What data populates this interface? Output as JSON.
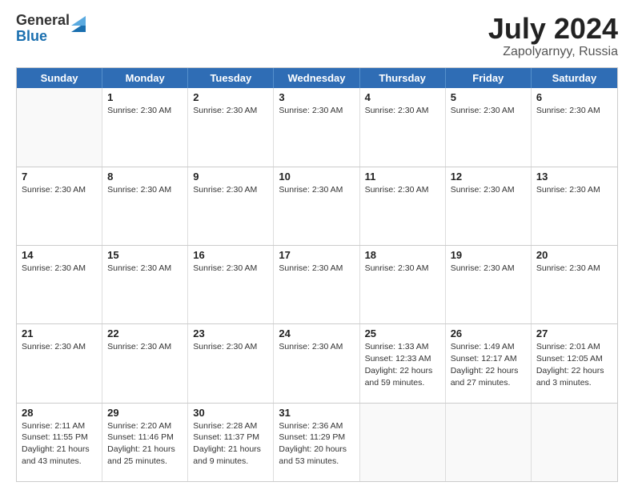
{
  "header": {
    "logo_general": "General",
    "logo_blue": "Blue",
    "main_title": "July 2024",
    "subtitle": "Zapolyarnyy, Russia"
  },
  "calendar": {
    "days_of_week": [
      "Sunday",
      "Monday",
      "Tuesday",
      "Wednesday",
      "Thursday",
      "Friday",
      "Saturday"
    ],
    "weeks": [
      [
        {
          "day": "",
          "info": []
        },
        {
          "day": "1",
          "info": [
            "Sunrise: 2:30 AM"
          ]
        },
        {
          "day": "2",
          "info": [
            "Sunrise: 2:30 AM"
          ]
        },
        {
          "day": "3",
          "info": [
            "Sunrise: 2:30 AM"
          ]
        },
        {
          "day": "4",
          "info": [
            "Sunrise: 2:30 AM"
          ]
        },
        {
          "day": "5",
          "info": [
            "Sunrise: 2:30 AM"
          ]
        },
        {
          "day": "6",
          "info": [
            "Sunrise: 2:30 AM"
          ]
        }
      ],
      [
        {
          "day": "7",
          "info": [
            "Sunrise: 2:30 AM"
          ]
        },
        {
          "day": "8",
          "info": [
            "Sunrise: 2:30 AM"
          ]
        },
        {
          "day": "9",
          "info": [
            "Sunrise: 2:30 AM"
          ]
        },
        {
          "day": "10",
          "info": [
            "Sunrise: 2:30 AM"
          ]
        },
        {
          "day": "11",
          "info": [
            "Sunrise: 2:30 AM"
          ]
        },
        {
          "day": "12",
          "info": [
            "Sunrise: 2:30 AM"
          ]
        },
        {
          "day": "13",
          "info": [
            "Sunrise: 2:30 AM"
          ]
        }
      ],
      [
        {
          "day": "14",
          "info": [
            "Sunrise: 2:30 AM"
          ]
        },
        {
          "day": "15",
          "info": [
            "Sunrise: 2:30 AM"
          ]
        },
        {
          "day": "16",
          "info": [
            "Sunrise: 2:30 AM"
          ]
        },
        {
          "day": "17",
          "info": [
            "Sunrise: 2:30 AM"
          ]
        },
        {
          "day": "18",
          "info": [
            "Sunrise: 2:30 AM"
          ]
        },
        {
          "day": "19",
          "info": [
            "Sunrise: 2:30 AM"
          ]
        },
        {
          "day": "20",
          "info": [
            "Sunrise: 2:30 AM"
          ]
        }
      ],
      [
        {
          "day": "21",
          "info": [
            "Sunrise: 2:30 AM"
          ]
        },
        {
          "day": "22",
          "info": [
            "Sunrise: 2:30 AM"
          ]
        },
        {
          "day": "23",
          "info": [
            "Sunrise: 2:30 AM"
          ]
        },
        {
          "day": "24",
          "info": [
            "Sunrise: 2:30 AM"
          ]
        },
        {
          "day": "25",
          "info": [
            "Sunrise: 1:33 AM",
            "Sunset: 12:33 AM",
            "Daylight: 22 hours and 59 minutes."
          ]
        },
        {
          "day": "26",
          "info": [
            "Sunrise: 1:49 AM",
            "Sunset: 12:17 AM",
            "Daylight: 22 hours and 27 minutes."
          ]
        },
        {
          "day": "27",
          "info": [
            "Sunrise: 2:01 AM",
            "Sunset: 12:05 AM",
            "Daylight: 22 hours and 3 minutes."
          ]
        }
      ],
      [
        {
          "day": "28",
          "info": [
            "Sunrise: 2:11 AM",
            "Sunset: 11:55 PM",
            "Daylight: 21 hours and 43 minutes."
          ]
        },
        {
          "day": "29",
          "info": [
            "Sunrise: 2:20 AM",
            "Sunset: 11:46 PM",
            "Daylight: 21 hours and 25 minutes."
          ]
        },
        {
          "day": "30",
          "info": [
            "Sunrise: 2:28 AM",
            "Sunset: 11:37 PM",
            "Daylight: 21 hours and 9 minutes."
          ]
        },
        {
          "day": "31",
          "info": [
            "Sunrise: 2:36 AM",
            "Sunset: 11:29 PM",
            "Daylight: 20 hours and 53 minutes."
          ]
        },
        {
          "day": "",
          "info": []
        },
        {
          "day": "",
          "info": []
        },
        {
          "day": "",
          "info": []
        }
      ]
    ]
  }
}
